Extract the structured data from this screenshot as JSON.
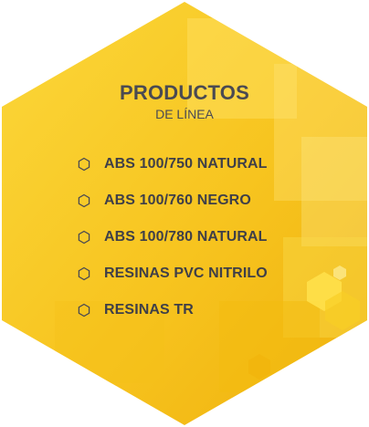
{
  "panel": {
    "title": "PRODUCTOS",
    "subtitle": "DE LÍNEA",
    "colors": {
      "hexagon_light": "#fbd73a",
      "hexagon_mid": "#f7c41f",
      "hexagon_dark": "#efb10d",
      "text": "#4a4a52"
    }
  },
  "products": [
    {
      "label": "ABS 100/750 NATURAL",
      "icon": "hexagon-outline-icon"
    },
    {
      "label": "ABS 100/760 NEGRO",
      "icon": "hexagon-outline-icon"
    },
    {
      "label": "ABS 100/780 NATURAL",
      "icon": "hexagon-outline-icon"
    },
    {
      "label": "RESINAS PVC NITRILO",
      "icon": "hexagon-outline-icon"
    },
    {
      "label": "RESINAS TR",
      "icon": "hexagon-outline-icon"
    }
  ]
}
